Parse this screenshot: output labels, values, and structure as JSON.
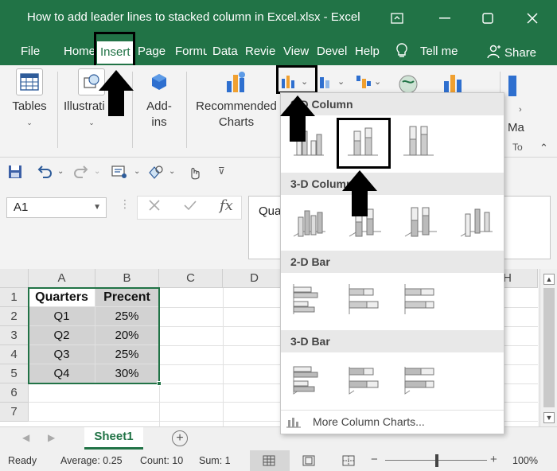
{
  "window": {
    "title": "How to add leader lines to stacked column in Excel.xlsx  -  Excel",
    "accent": "#217346"
  },
  "tabs": [
    {
      "label": "File"
    },
    {
      "label": "Home"
    },
    {
      "label": "Insert"
    },
    {
      "label": "Page L"
    },
    {
      "label": "Formu"
    },
    {
      "label": "Data"
    },
    {
      "label": "Revie"
    },
    {
      "label": "View"
    },
    {
      "label": "Devel"
    },
    {
      "label": "Help"
    }
  ],
  "tellme": "Tell me",
  "share": "Share",
  "ribbon": {
    "tables": "Tables",
    "illustrations": "Illustrati",
    "addins": "Add-\nins",
    "recommended": "Recommended\nCharts",
    "maps": "Ma",
    "to": "To"
  },
  "namebox": "A1",
  "formula": "Qua",
  "columns": [
    "A",
    "B",
    "C",
    "D",
    "H"
  ],
  "rows": [
    "1",
    "2",
    "3",
    "4",
    "5",
    "6",
    "7"
  ],
  "table": {
    "headers": [
      "Quarters",
      "Precent"
    ],
    "data": [
      [
        "Q1",
        "25%"
      ],
      [
        "Q2",
        "20%"
      ],
      [
        "Q3",
        "25%"
      ],
      [
        "Q4",
        "30%"
      ]
    ]
  },
  "sheet": "Sheet1",
  "status": {
    "ready": "Ready",
    "average": "Average: 0.25",
    "count": "Count: 10",
    "sum": "Sum: 1",
    "zoom": "100%"
  },
  "gallery": {
    "sections": [
      "2-D Column",
      "3-D Column",
      "2-D Bar",
      "3-D Bar"
    ],
    "footer": "More Column Charts..."
  }
}
